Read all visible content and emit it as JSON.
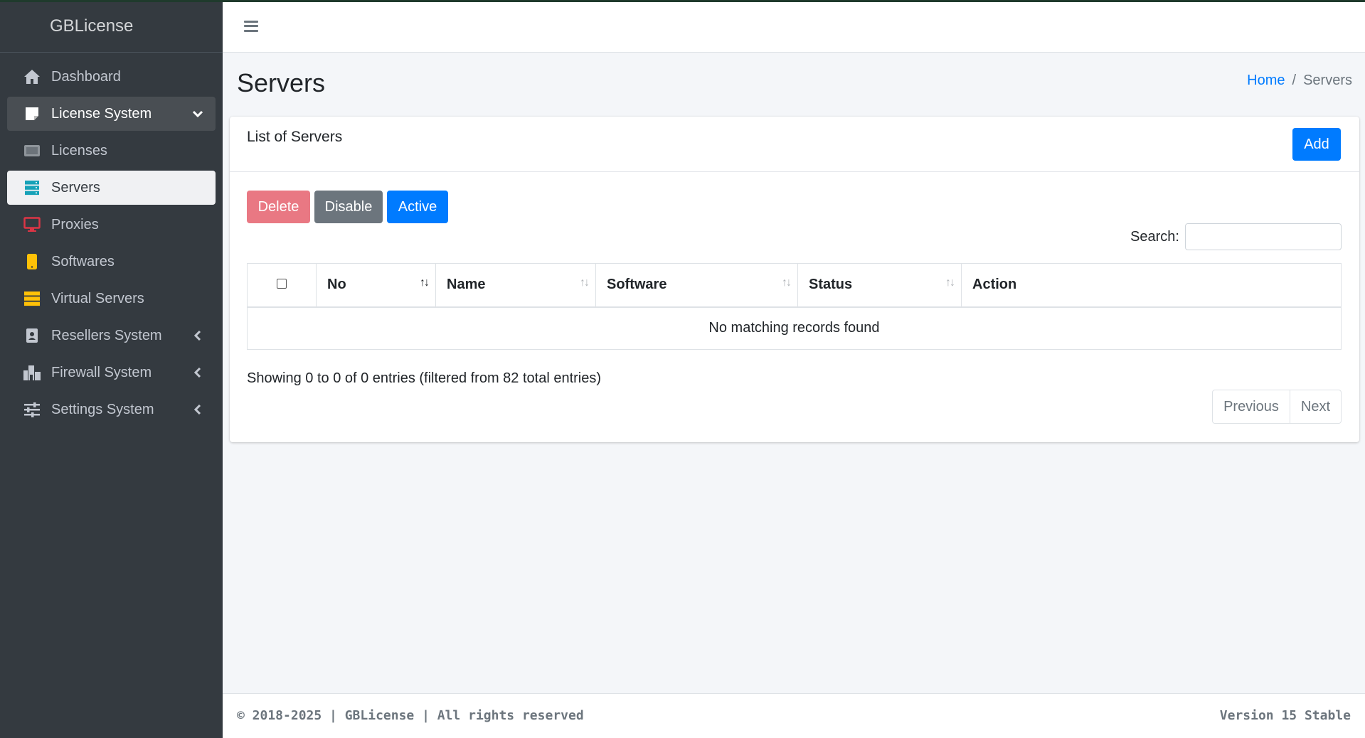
{
  "brand": "GBLicense",
  "sidebar": {
    "items": [
      {
        "label": "Dashboard",
        "icon": "home-icon",
        "color": "#c2c7d0"
      },
      {
        "label": "License System",
        "icon": "sticky-note-icon",
        "color": "#ffffff"
      },
      {
        "label": "Licenses",
        "icon": "licenses-icon",
        "color": "#8f959b"
      },
      {
        "label": "Servers",
        "icon": "server-icon",
        "color": "#17a2b8"
      },
      {
        "label": "Proxies",
        "icon": "monitor-icon",
        "color": "#dc3545"
      },
      {
        "label": "Softwares",
        "icon": "mobile-icon",
        "color": "#ffc107"
      },
      {
        "label": "Virtual Servers",
        "icon": "virtual-server-icon",
        "color": "#ffc107"
      },
      {
        "label": "Resellers System",
        "icon": "id-badge-icon",
        "color": "#c2c7d0"
      },
      {
        "label": "Firewall System",
        "icon": "firewall-icon",
        "color": "#c2c7d0"
      },
      {
        "label": "Settings System",
        "icon": "sliders-icon",
        "color": "#c2c7d0"
      }
    ]
  },
  "header": {
    "title": "Servers",
    "breadcrumb": {
      "home": "Home",
      "separator": "/",
      "current": "Servers"
    }
  },
  "card": {
    "title": "List of Servers",
    "add_label": "Add",
    "delete_label": "Delete",
    "disable_label": "Disable",
    "active_label": "Active",
    "search_label": "Search:",
    "search_value": ""
  },
  "table": {
    "columns": [
      "No",
      "Name",
      "Software",
      "Status",
      "Action"
    ],
    "empty_message": "No matching records found"
  },
  "info": "Showing 0 to 0 of 0 entries (filtered from 82 total entries)",
  "pagination": {
    "previous": "Previous",
    "next": "Next"
  },
  "footer": {
    "copyright": "© 2018-2025 | GBLicense | All rights reserved",
    "version": "Version 15 Stable"
  },
  "colors": {
    "sidebar_bg": "#343a40",
    "primary": "#007bff",
    "danger": "#e97883",
    "secondary": "#6c757d"
  }
}
